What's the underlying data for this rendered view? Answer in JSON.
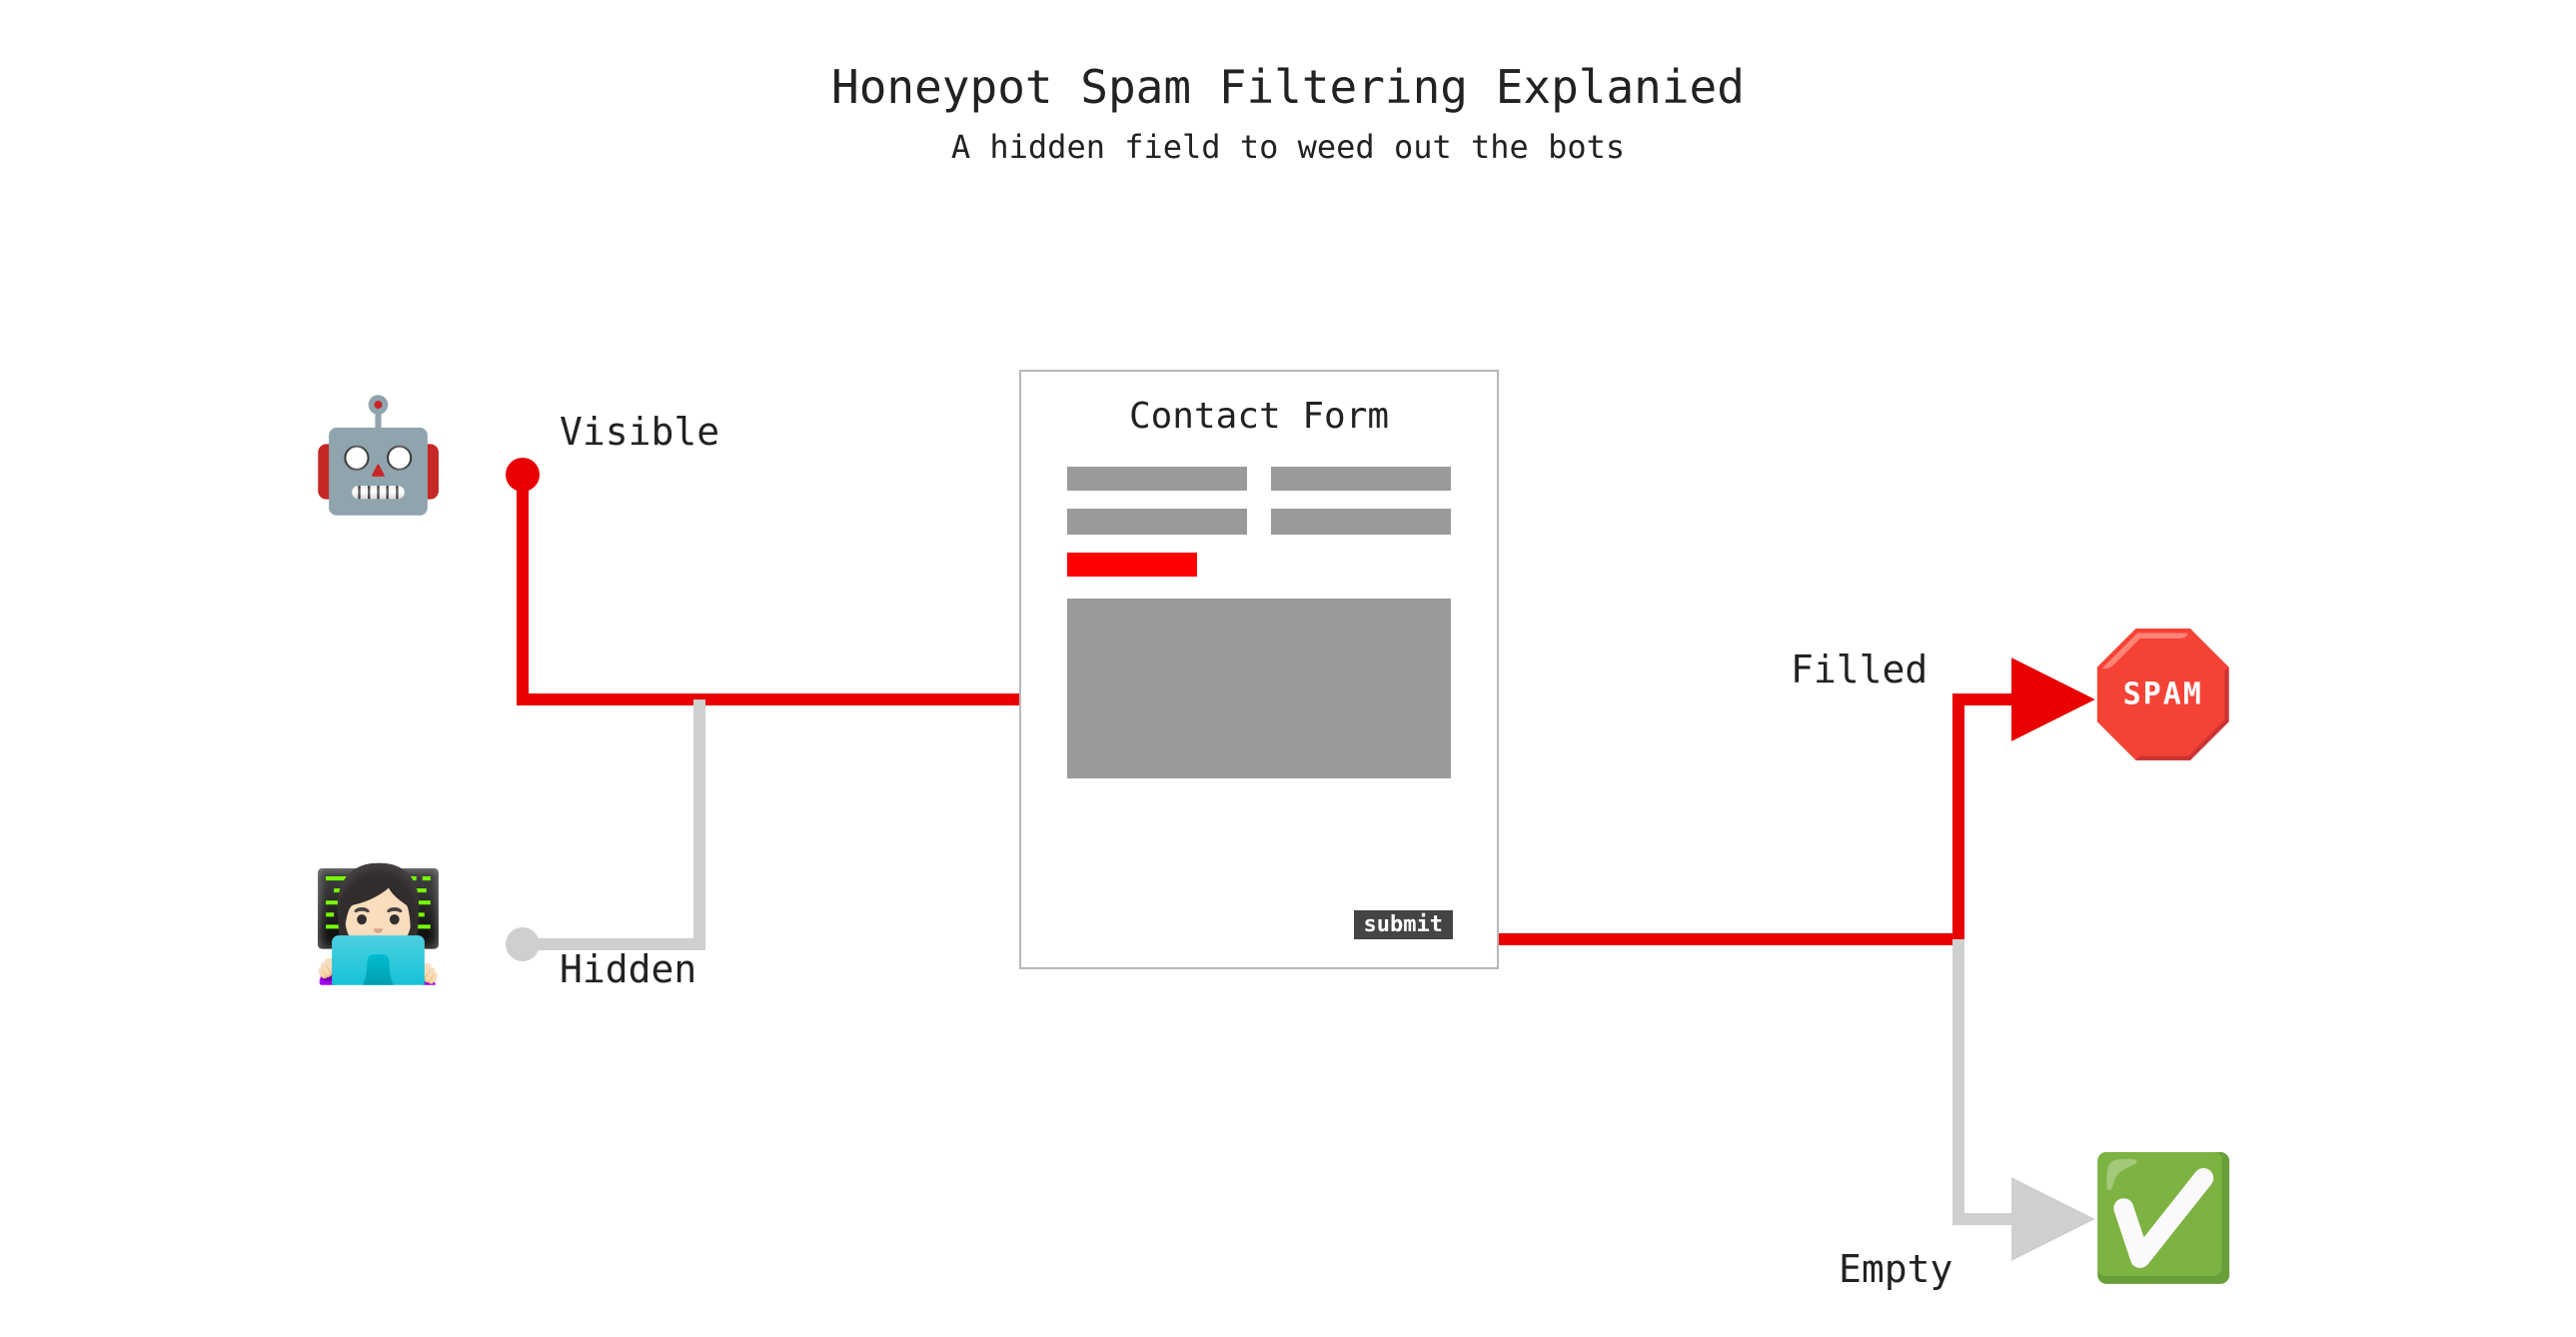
{
  "title": "Honeypot Spam Filtering Explanied",
  "subtitle": "A hidden field to weed out the bots",
  "actors": {
    "bot_label": "Visible",
    "human_label": "Hidden"
  },
  "form": {
    "title": "Contact Form",
    "submit_label": "submit"
  },
  "outcomes": {
    "filled_label": "Filled",
    "empty_label": "Empty",
    "spam_word": "SPAM"
  },
  "colors": {
    "red": "#e90000",
    "gray": "#cfcfcf",
    "field_gray": "#9a9a9a",
    "border_gray": "#b9b9b9"
  }
}
